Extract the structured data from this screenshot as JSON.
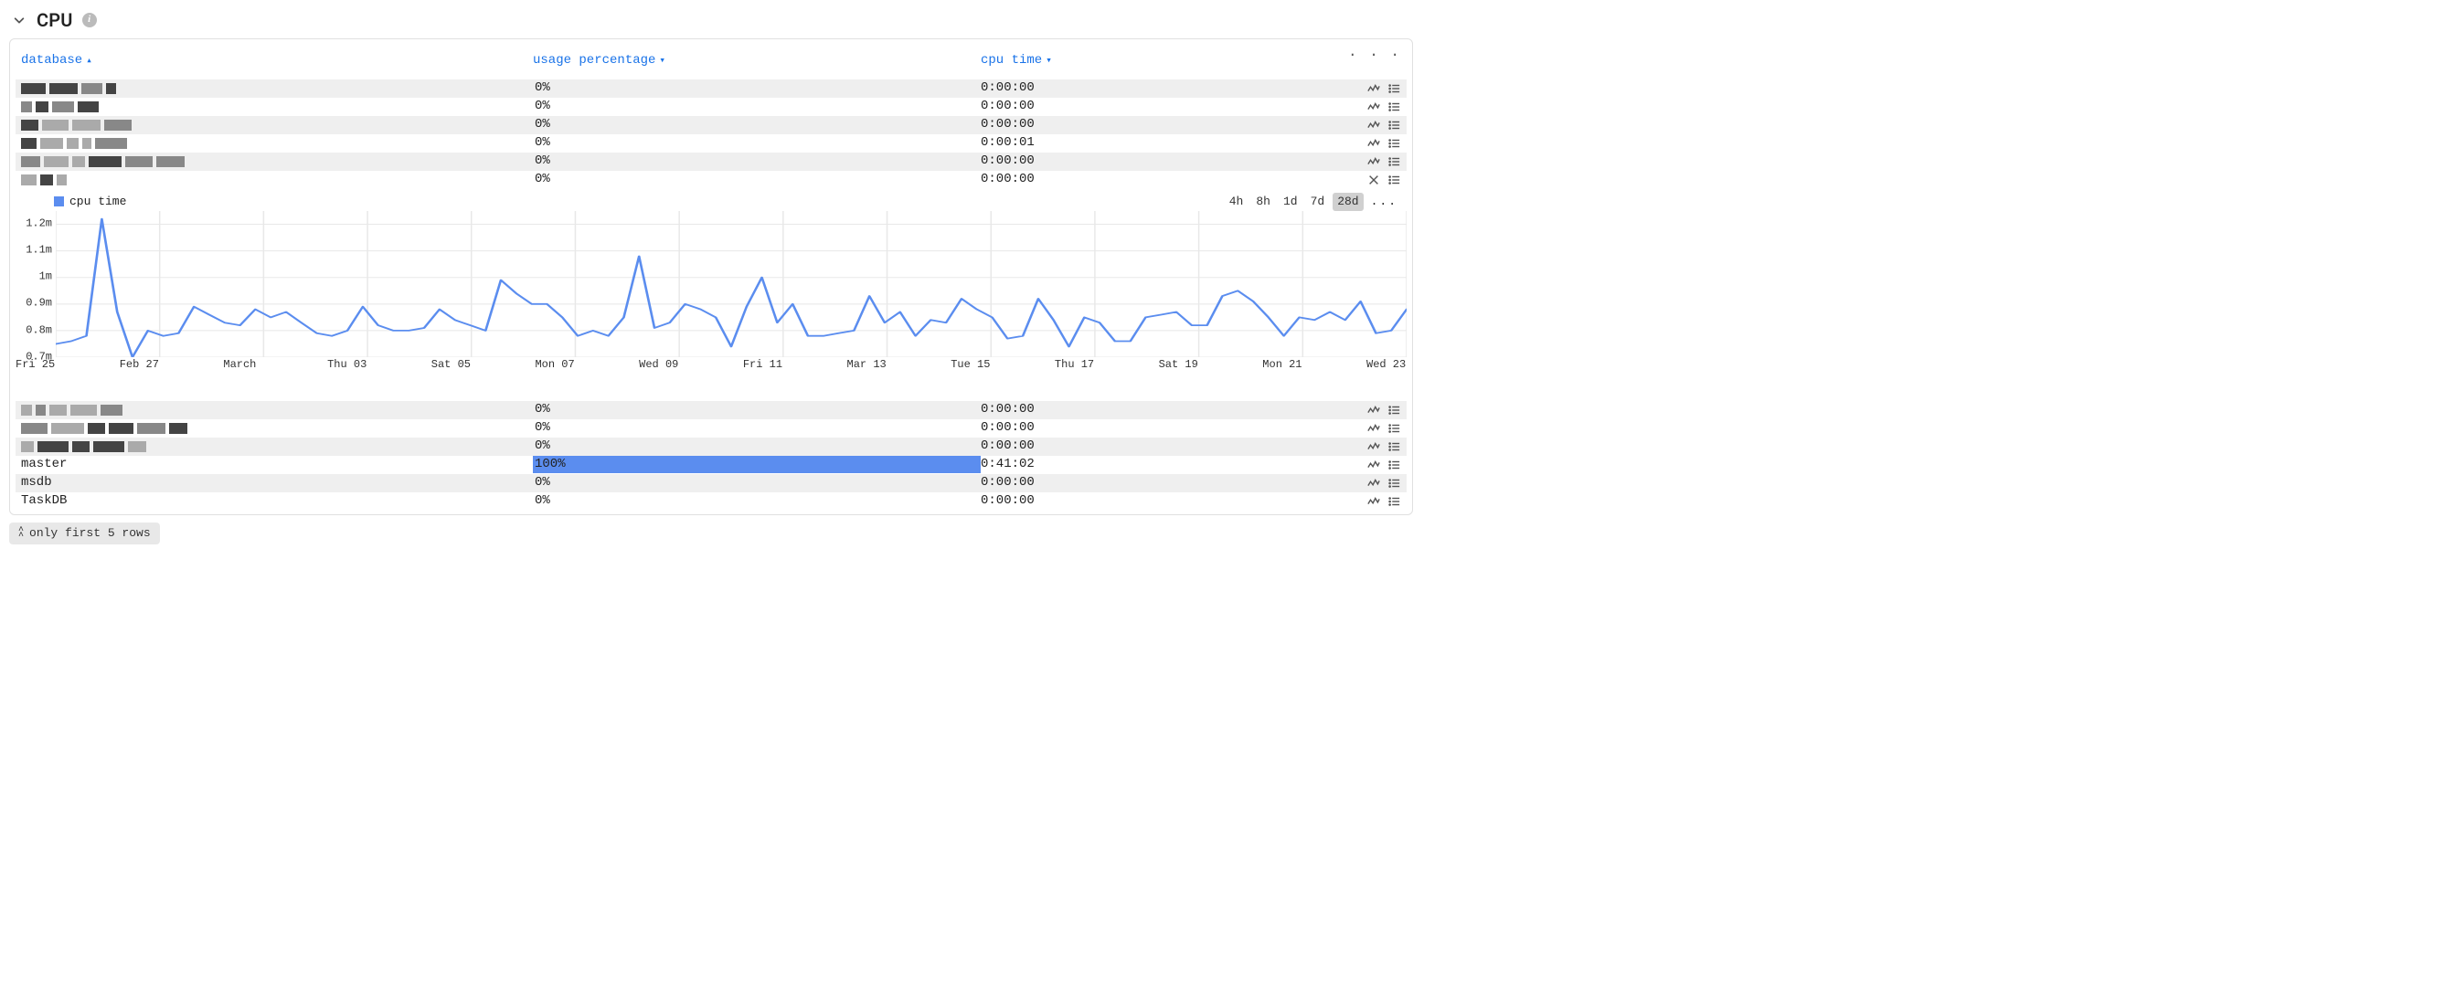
{
  "section": {
    "title": "CPU"
  },
  "columns": {
    "database": "database",
    "usage": "usage percentage",
    "cpu_time": "cpu time"
  },
  "rows_top": [
    {
      "database": "",
      "redacted": true,
      "usage_pct": 0,
      "usage_label": "0%",
      "cpu_time": "0:00:00",
      "action": "chart"
    },
    {
      "database": "",
      "redacted": true,
      "usage_pct": 0,
      "usage_label": "0%",
      "cpu_time": "0:00:00",
      "action": "chart"
    },
    {
      "database": "",
      "redacted": true,
      "usage_pct": 0,
      "usage_label": "0%",
      "cpu_time": "0:00:00",
      "action": "chart"
    },
    {
      "database": "",
      "redacted": true,
      "usage_pct": 0,
      "usage_label": "0%",
      "cpu_time": "0:00:01",
      "action": "chart"
    },
    {
      "database": "",
      "redacted": true,
      "usage_pct": 0,
      "usage_label": "0%",
      "cpu_time": "0:00:00",
      "action": "chart"
    },
    {
      "database": "",
      "redacted": true,
      "usage_pct": 0,
      "usage_label": "0%",
      "cpu_time": "0:00:00",
      "action": "close"
    }
  ],
  "rows_bottom": [
    {
      "database": "",
      "redacted": true,
      "usage_pct": 0,
      "usage_label": "0%",
      "cpu_time": "0:00:00",
      "action": "chart"
    },
    {
      "database": "",
      "redacted": true,
      "usage_pct": 0,
      "usage_label": "0%",
      "cpu_time": "0:00:00",
      "action": "chart"
    },
    {
      "database": "",
      "redacted": true,
      "usage_pct": 0,
      "usage_label": "0%",
      "cpu_time": "0:00:00",
      "action": "chart"
    },
    {
      "database": "master",
      "redacted": false,
      "usage_pct": 100,
      "usage_label": "100%",
      "cpu_time": "0:41:02",
      "action": "chart"
    },
    {
      "database": "msdb",
      "redacted": false,
      "usage_pct": 0,
      "usage_label": "0%",
      "cpu_time": "0:00:00",
      "action": "chart"
    },
    {
      "database": "TaskDB",
      "redacted": false,
      "usage_pct": 0,
      "usage_label": "0%",
      "cpu_time": "0:00:00",
      "action": "chart"
    }
  ],
  "footer": {
    "label": "only first 5 rows"
  },
  "chart_data": {
    "type": "line",
    "legend": "cpu time",
    "ylabel": "",
    "ylim": [
      0.7,
      1.25
    ],
    "yticks": [
      "1.2m",
      "1.1m",
      "1m",
      "0.9m",
      "0.8m",
      "0.7m"
    ],
    "ytick_vals": [
      1.2,
      1.1,
      1.0,
      0.9,
      0.8,
      0.7
    ],
    "x_labels": [
      "Fri 25",
      "Feb 27",
      "March",
      "Thu 03",
      "Sat 05",
      "Mon 07",
      "Wed 09",
      "Fri 11",
      "Mar 13",
      "Tue 15",
      "Thu 17",
      "Sat 19",
      "Mon 21",
      "Wed 23"
    ],
    "range_options": [
      "4h",
      "8h",
      "1d",
      "7d",
      "28d"
    ],
    "range_selected": "28d",
    "series": [
      {
        "name": "cpu time",
        "color": "#5b8def",
        "values": [
          0.75,
          0.76,
          0.78,
          1.22,
          0.87,
          0.7,
          0.8,
          0.78,
          0.79,
          0.89,
          0.86,
          0.83,
          0.82,
          0.88,
          0.85,
          0.87,
          0.83,
          0.79,
          0.78,
          0.8,
          0.89,
          0.82,
          0.8,
          0.8,
          0.81,
          0.88,
          0.84,
          0.82,
          0.8,
          0.99,
          0.94,
          0.9,
          0.9,
          0.85,
          0.78,
          0.8,
          0.78,
          0.85,
          1.08,
          0.81,
          0.83,
          0.9,
          0.88,
          0.85,
          0.74,
          0.89,
          1.0,
          0.83,
          0.9,
          0.78,
          0.78,
          0.79,
          0.8,
          0.93,
          0.83,
          0.87,
          0.78,
          0.84,
          0.83,
          0.92,
          0.88,
          0.85,
          0.77,
          0.78,
          0.92,
          0.84,
          0.74,
          0.85,
          0.83,
          0.76,
          0.76,
          0.85,
          0.86,
          0.87,
          0.82,
          0.82,
          0.93,
          0.95,
          0.91,
          0.85,
          0.78,
          0.85,
          0.84,
          0.87,
          0.84,
          0.91,
          0.79,
          0.8,
          0.88
        ]
      }
    ]
  }
}
